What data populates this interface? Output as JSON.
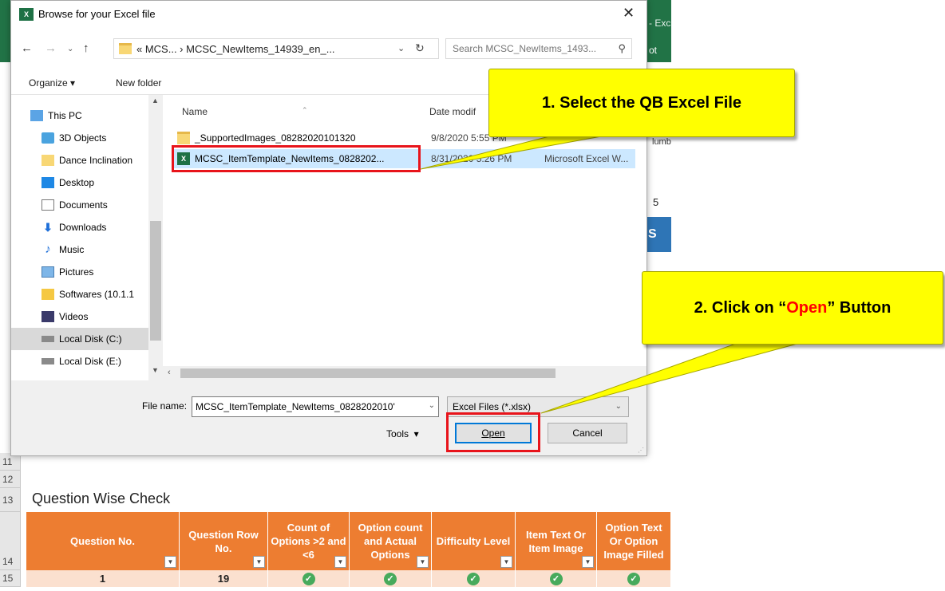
{
  "excel": {
    "ribbon_text_1": "- Exc",
    "ribbon_text_2": "ot",
    "partial_1": "lumb",
    "partial_2": "5",
    "partial_3": "S Fi",
    "row_numbers": [
      "11",
      "12",
      "13",
      "14",
      "15"
    ],
    "section_title": "Question Wise Check",
    "table": {
      "headers": [
        "Question No.",
        "Question Row No.",
        "Count of Options >2 and <6",
        "Option count and Actual Options",
        "Difficulty Level",
        "Item Text Or Item Image",
        "Option Text Or Option Image Filled"
      ],
      "row": [
        "1",
        "19"
      ],
      "check_count": 5
    }
  },
  "dialog": {
    "title": "Browse for your Excel file",
    "address": "« MCS... › MCSC_NewItems_14939_en_...",
    "search_placeholder": "Search MCSC_NewItems_1493...",
    "organize_label": "Organize ▾",
    "new_folder_label": "New folder",
    "nav_items": [
      {
        "label": "This PC",
        "icon": "pc-icon"
      },
      {
        "label": "3D Objects",
        "icon": "cube-icon"
      },
      {
        "label": "Dance Inclination",
        "icon": "folder-icon"
      },
      {
        "label": "Desktop",
        "icon": "desktop-icon"
      },
      {
        "label": "Documents",
        "icon": "documents-icon"
      },
      {
        "label": "Downloads",
        "icon": "download-icon"
      },
      {
        "label": "Music",
        "icon": "music-icon"
      },
      {
        "label": "Pictures",
        "icon": "pictures-icon"
      },
      {
        "label": "Softwares (10.1.1",
        "icon": "network-drive-icon"
      },
      {
        "label": "Videos",
        "icon": "videos-icon"
      },
      {
        "label": "Local Disk (C:)",
        "icon": "disk-icon"
      },
      {
        "label": "Local Disk (E:)",
        "icon": "disk-icon"
      }
    ],
    "columns": {
      "name": "Name",
      "date": "Date modif"
    },
    "files": [
      {
        "name": "_SupportedImages_08282020101320",
        "date": "9/8/2020 5:55 PM",
        "type": "",
        "icon": "folder-icon"
      },
      {
        "name": "MCSC_ItemTemplate_NewItems_0828202...",
        "date": "8/31/2020 5:26 PM",
        "type": "Microsoft Excel W...",
        "icon": "excel-icon"
      }
    ],
    "file_name_label": "File name:",
    "file_name_value": "MCSC_ItemTemplate_NewItems_0828202010'",
    "file_type": "Excel Files (*.xlsx)",
    "tools_label": "Tools",
    "open_label": "Open",
    "cancel_label": "Cancel"
  },
  "callouts": {
    "step1": "1. Select the QB Excel File",
    "step2_prefix": "2. Click on “",
    "step2_highlight": "Open",
    "step2_suffix": "” Button"
  },
  "colors": {
    "excel_green": "#217346",
    "header_orange": "#ed7d31",
    "row_peach": "#fbe0cf",
    "callout_yellow": "#ffff00",
    "annotation_red": "#e8141b",
    "check_green": "#47aa5c",
    "selection_blue": "#cce8ff"
  }
}
